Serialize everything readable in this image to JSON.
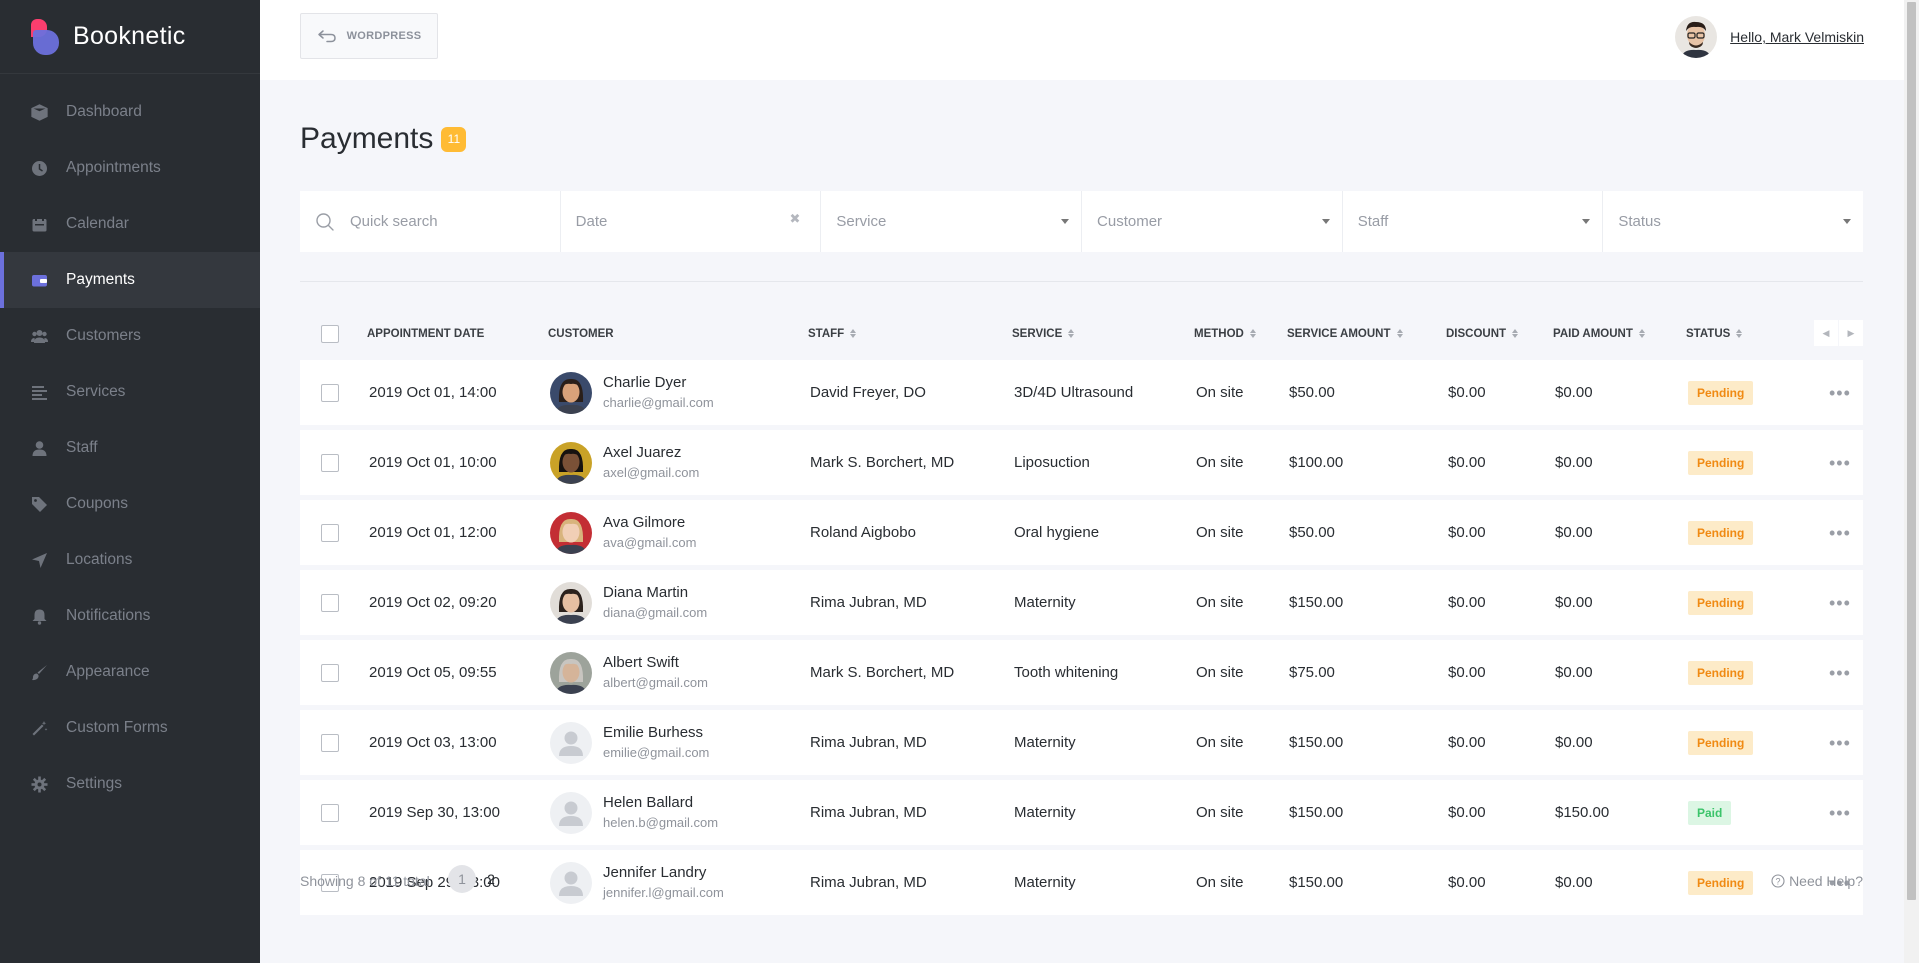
{
  "brand": {
    "name": "Booknetic"
  },
  "sidebar": {
    "items": [
      {
        "label": "Dashboard",
        "icon": "cube-icon"
      },
      {
        "label": "Appointments",
        "icon": "clock-icon"
      },
      {
        "label": "Calendar",
        "icon": "calendar-icon"
      },
      {
        "label": "Payments",
        "icon": "wallet-icon",
        "active": true
      },
      {
        "label": "Customers",
        "icon": "users-icon"
      },
      {
        "label": "Services",
        "icon": "list-icon"
      },
      {
        "label": "Staff",
        "icon": "user-icon"
      },
      {
        "label": "Coupons",
        "icon": "tag-icon"
      },
      {
        "label": "Locations",
        "icon": "location-arrow-icon"
      },
      {
        "label": "Notifications",
        "icon": "bell-icon"
      },
      {
        "label": "Appearance",
        "icon": "brush-icon"
      },
      {
        "label": "Custom Forms",
        "icon": "magic-icon"
      },
      {
        "label": "Settings",
        "icon": "gear-icon"
      }
    ]
  },
  "topbar": {
    "wordpress_label": "WORDPRESS",
    "greeting": "Hello, Mark Velmiskin"
  },
  "page": {
    "title": "Payments",
    "count": "11"
  },
  "filters": {
    "search_placeholder": "Quick search",
    "date": "Date",
    "service": "Service",
    "customer": "Customer",
    "staff": "Staff",
    "status": "Status"
  },
  "table": {
    "headers": {
      "date": "APPOINTMENT DATE",
      "customer": "CUSTOMER",
      "staff": "STAFF",
      "service": "SERVICE",
      "method": "METHOD",
      "service_amount": "SERVICE AMOUNT",
      "discount": "DISCOUNT",
      "paid_amount": "PAID AMOUNT",
      "status": "STATUS"
    },
    "rows": [
      {
        "date": "2019 Oct 01, 14:00",
        "name": "Charlie Dyer",
        "email": "charlie@gmail.com",
        "staff": "David Freyer, DO",
        "service": "3D/4D Ultrasound",
        "method": "On site",
        "amount": "$50.00",
        "discount": "$0.00",
        "paid": "$0.00",
        "status": "Pending",
        "avatar": {
          "bg": "#3a4a6b",
          "skin": "#d9a27a",
          "hair": "#2a1f1a"
        }
      },
      {
        "date": "2019 Oct 01, 10:00",
        "name": "Axel Juarez",
        "email": "axel@gmail.com",
        "staff": "Mark S. Borchert, MD",
        "service": "Liposuction",
        "method": "On site",
        "amount": "$100.00",
        "discount": "$0.00",
        "paid": "$0.00",
        "status": "Pending",
        "avatar": {
          "bg": "#c9a227",
          "skin": "#7a5137",
          "hair": "#161210"
        }
      },
      {
        "date": "2019 Oct 01, 12:00",
        "name": "Ava Gilmore",
        "email": "ava@gmail.com",
        "staff": "Roland Aigbobo",
        "service": "Oral hygiene",
        "method": "On site",
        "amount": "$50.00",
        "discount": "$0.00",
        "paid": "$0.00",
        "status": "Pending",
        "avatar": {
          "bg": "#c32e34",
          "skin": "#f1cfb6",
          "hair": "#d8b47d"
        }
      },
      {
        "date": "2019 Oct 02, 09:20",
        "name": "Diana Martin",
        "email": "diana@gmail.com",
        "staff": "Rima Jubran, MD",
        "service": "Maternity",
        "method": "On site",
        "amount": "$150.00",
        "discount": "$0.00",
        "paid": "$0.00",
        "status": "Pending",
        "avatar": {
          "bg": "#e1ddd8",
          "skin": "#e6bfa2",
          "hair": "#2b211c"
        }
      },
      {
        "date": "2019 Oct 05, 09:55",
        "name": "Albert Swift",
        "email": "albert@gmail.com",
        "staff": "Mark S. Borchert, MD",
        "service": "Tooth whitening",
        "method": "On site",
        "amount": "$75.00",
        "discount": "$0.00",
        "paid": "$0.00",
        "status": "Pending",
        "avatar": {
          "bg": "#9da39b",
          "skin": "#d5b499",
          "hair": "#c8c5c0"
        }
      },
      {
        "date": "2019 Oct 03, 13:00",
        "name": "Emilie Burhess",
        "email": "emilie@gmail.com",
        "staff": "Rima Jubran, MD",
        "service": "Maternity",
        "method": "On site",
        "amount": "$150.00",
        "discount": "$0.00",
        "paid": "$0.00",
        "status": "Pending",
        "avatar": null
      },
      {
        "date": "2019 Sep 30, 13:00",
        "name": "Helen Ballard",
        "email": "helen.b@gmail.com",
        "staff": "Rima Jubran, MD",
        "service": "Maternity",
        "method": "On site",
        "amount": "$150.00",
        "discount": "$0.00",
        "paid": "$150.00",
        "status": "Paid",
        "avatar": null
      },
      {
        "date": "2019 Sep 29, 13:00",
        "name": "Jennifer Landry",
        "email": "jennifer.l@gmail.com",
        "staff": "Rima Jubran, MD",
        "service": "Maternity",
        "method": "On site",
        "amount": "$150.00",
        "discount": "$0.00",
        "paid": "$0.00",
        "status": "Pending",
        "avatar": null
      }
    ]
  },
  "footer": {
    "showing": "Showing 8 of 11 total",
    "pages": [
      "1",
      "2"
    ],
    "help": "Need Help?"
  },
  "colors": {
    "accent": "#6c70dc",
    "badge": "#ffbb34",
    "pending": "#f08a13",
    "paid": "#3bc46a"
  }
}
